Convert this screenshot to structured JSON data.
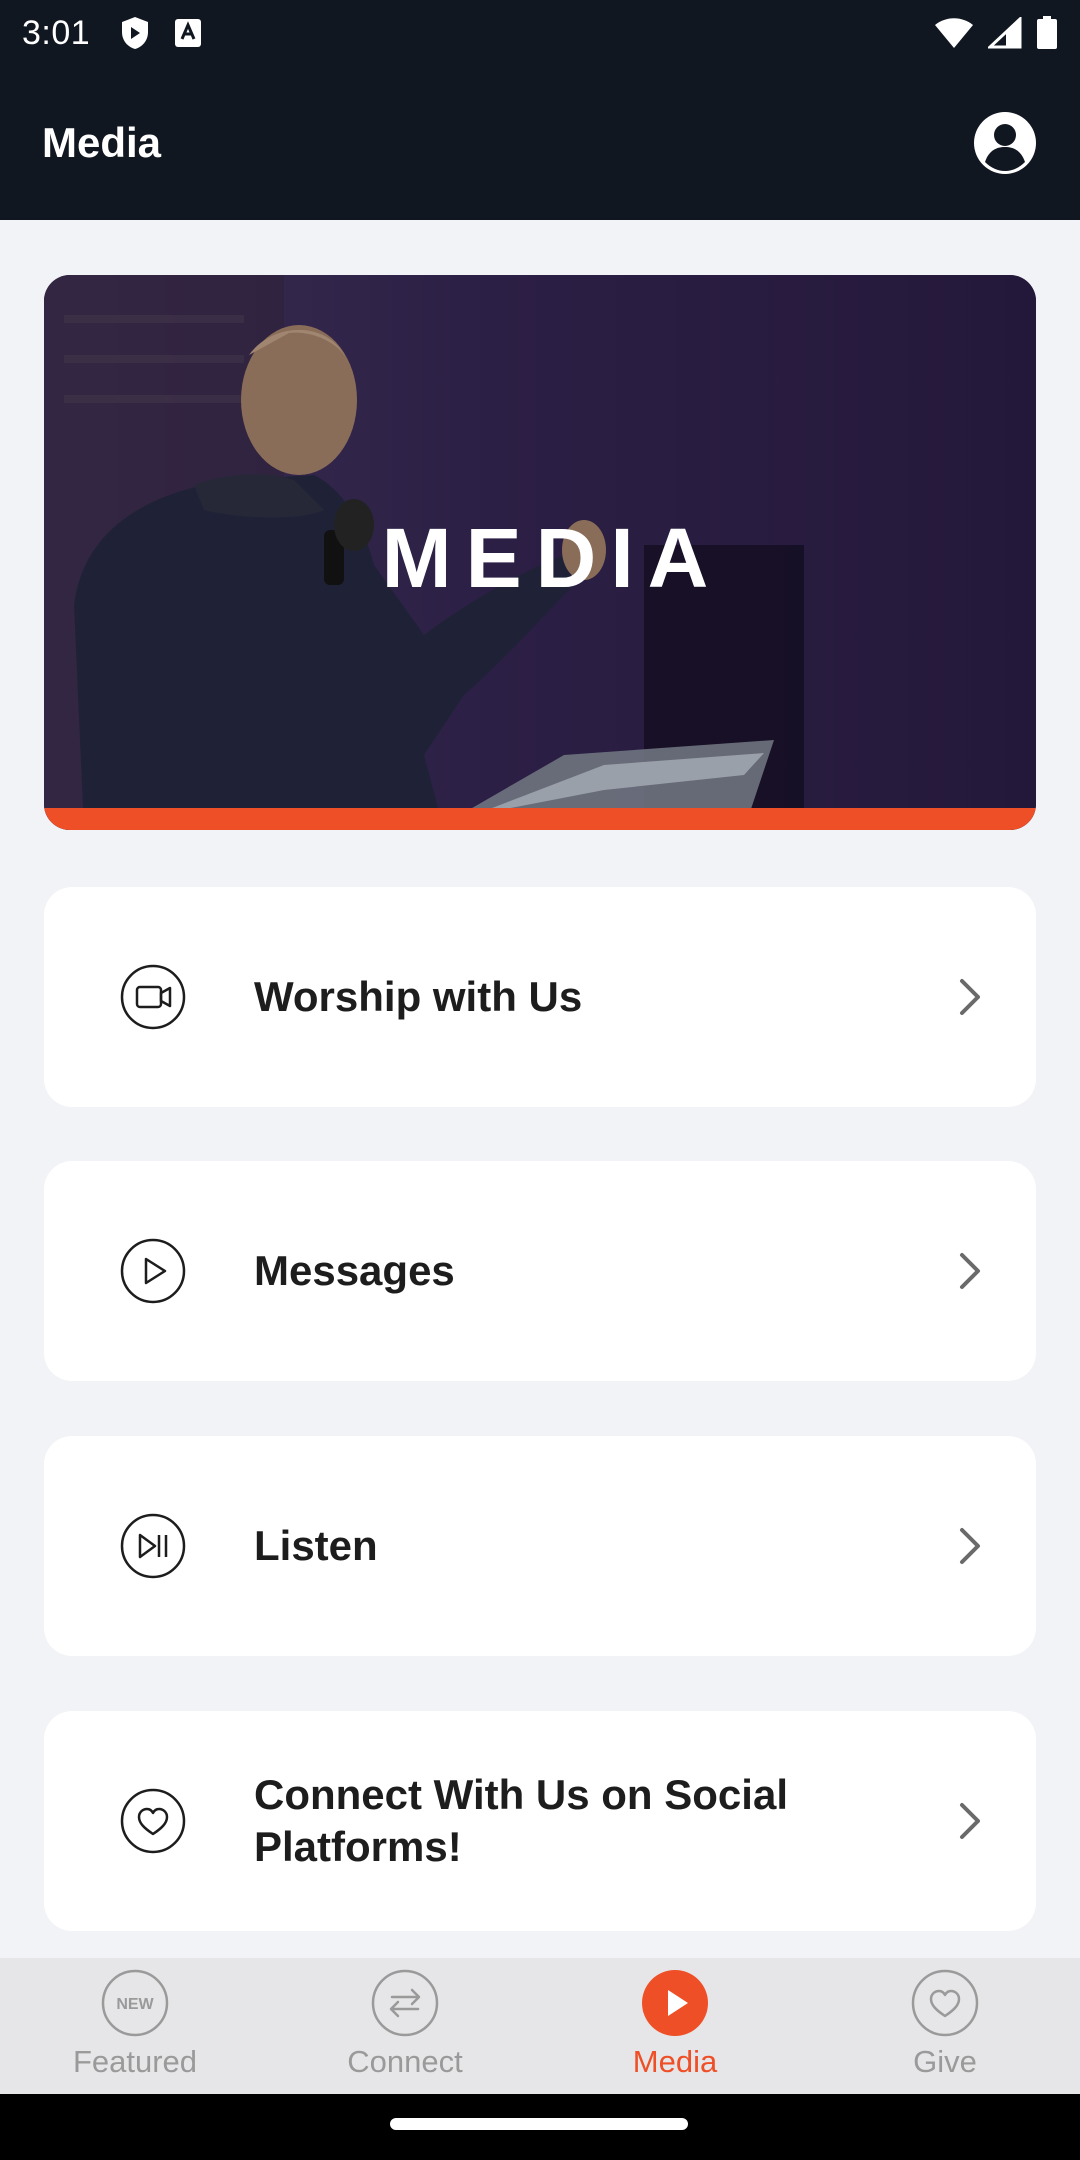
{
  "status_bar": {
    "time": "3:01"
  },
  "header": {
    "title": "Media"
  },
  "hero": {
    "title": "MEDIA",
    "accent_color": "#ee4f26"
  },
  "cards": [
    {
      "label": "Worship with Us",
      "icon": "video-camera-icon"
    },
    {
      "label": "Messages",
      "icon": "play-circle-icon"
    },
    {
      "label": "Listen",
      "icon": "play-pause-circle-icon"
    },
    {
      "label": "Connect With Us on Social Platforms!",
      "icon": "heart-circle-icon"
    }
  ],
  "bottom_nav": {
    "items": [
      {
        "label": "Featured",
        "icon": "new-badge-icon",
        "active": false
      },
      {
        "label": "Connect",
        "icon": "swap-arrows-icon",
        "active": false
      },
      {
        "label": "Media",
        "icon": "play-icon",
        "active": true
      },
      {
        "label": "Give",
        "icon": "heart-icon",
        "active": false
      }
    ],
    "new_badge_text": "NEW"
  },
  "colors": {
    "header_bg": "#111720",
    "accent": "#ee4f26",
    "page_bg": "#f2f3f6"
  }
}
